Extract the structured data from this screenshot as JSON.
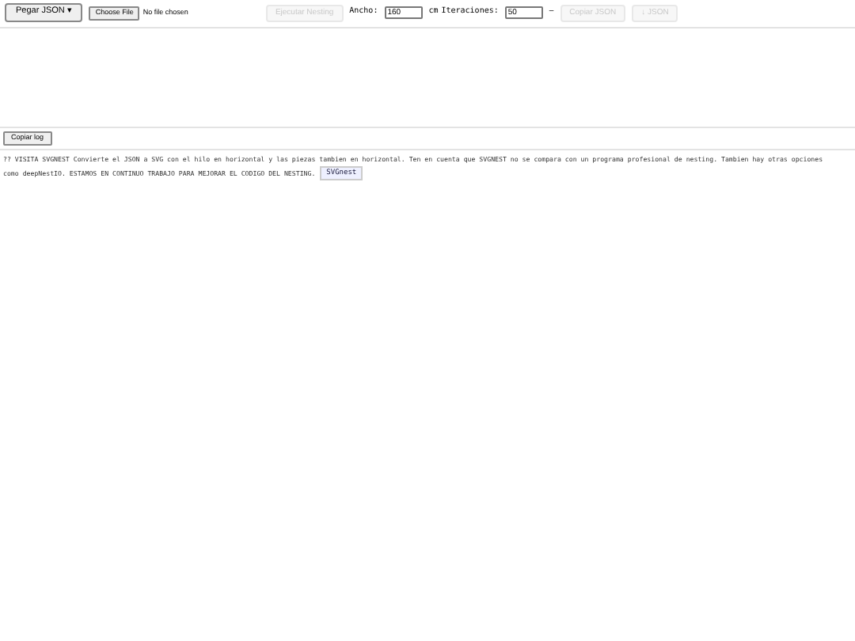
{
  "toolbar": {
    "paste_button": "Pegar JSON ▾",
    "file_button": "Choose File",
    "file_status": "No file chosen",
    "run_button": {
      "label": "Ejecutar Nesting",
      "disabled": true
    },
    "width_label": "Ancho:",
    "width_value": "160",
    "width_unit": "cm",
    "iterations_label": "Iteraciones:",
    "iterations_value": "50",
    "separator": "–",
    "copy_button": {
      "label": "Copiar JSON",
      "disabled": true
    },
    "download_button": {
      "label": "↓ JSON",
      "disabled": true
    }
  },
  "log_button": "Copiar log",
  "message_lines": [
    "?? VISITA SVGNEST Convierte el JSON a SVG con el hilo en horizontal y las piezas tambien en horizontal. Ten en cuenta que SVGNEST no se compara con un programa profesional de nesting. Tambien hay otras opciones",
    "como deepNestIO. ESTAMOS EN CONTINUO TRABAJO PARA MEJORAR EL CODIGO DEL NESTING."
  ],
  "link": "SVGnest"
}
